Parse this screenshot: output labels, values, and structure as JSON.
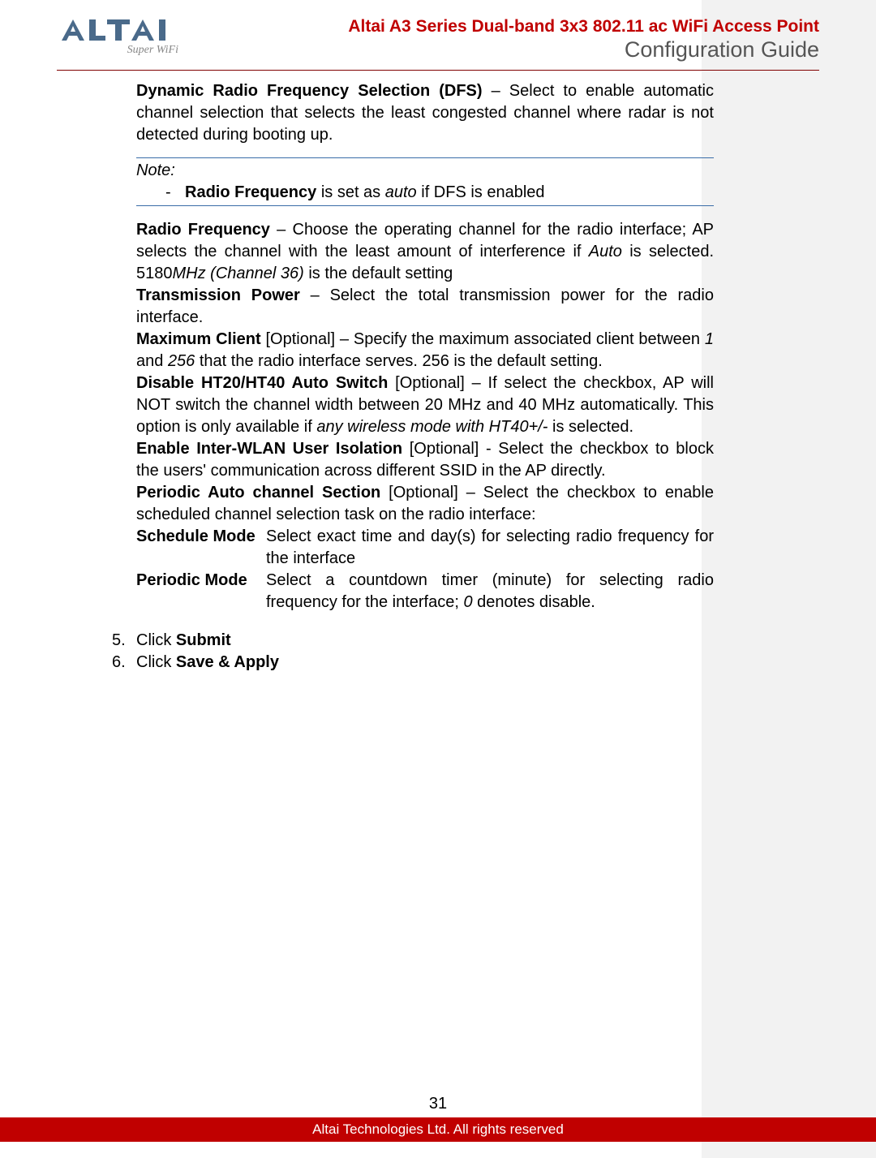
{
  "header": {
    "logo_text": "ALTAI",
    "logo_tagline": "Super WiFi",
    "title1": "Altai A3 Series Dual-band 3x3 802.11 ac WiFi Access Point",
    "title2": "Configuration Guide"
  },
  "content": {
    "dfs_bold": "Dynamic Radio Frequency Selection (DFS)",
    "dfs_text": " – Select to enable automatic channel selection that selects the least congested channel where radar is not detected during booting up.",
    "note_label": "Note:",
    "note_item_bold": "Radio Frequency",
    "note_item_mid": " is set as ",
    "note_item_italic": "auto",
    "note_item_end": " if DFS is enabled",
    "rf_bold": "Radio Frequency",
    "rf_text_a": " – Choose the operating channel for the radio interface; AP selects the channel with the least amount of interference if ",
    "rf_auto": "Auto",
    "rf_text_b": " is selected.  5180",
    "rf_mhz": "MHz (Channel 36)",
    "rf_text_c": " is the default setting",
    "tx_bold": "Transmission Power",
    "tx_text": " – Select the total transmission power for the radio interface.",
    "mc_bold": "Maximum Client",
    "mc_text_a": " [Optional] – Specify the maximum associated client between ",
    "mc_1": "1",
    "mc_text_b": " and ",
    "mc_256": "256",
    "mc_text_c": " that the radio interface serves. 256 is the default setting.",
    "ht_bold": "Disable HT20/HT40 Auto Switch",
    "ht_text_a": " [Optional] – If select the checkbox, AP will NOT switch the channel width between 20 MHz and 40 MHz automatically. This option is only available if ",
    "ht_italic": "any wireless mode with HT40+/-",
    "ht_text_b": " is selected.",
    "iw_bold": "Enable Inter-WLAN User Isolation",
    "iw_text": " [Optional] - Select the checkbox to block the users' communication across different SSID in the AP directly.",
    "pa_bold": "Periodic Auto channel Section",
    "pa_text": " [Optional] – Select the checkbox to enable scheduled channel selection task on the radio interface:",
    "schedule_label": "Schedule Mode",
    "schedule_text": "Select exact time and day(s) for selecting radio frequency for the interface",
    "periodic_label": "Periodic Mode",
    "periodic_text_a": "Select a countdown timer (minute) for selecting radio frequency for the interface; ",
    "periodic_zero": "0",
    "periodic_text_b": " denotes disable.",
    "step5_num": "5.",
    "step5_a": "Click ",
    "step5_b": "Submit",
    "step6_num": "6.",
    "step6_a": "Click ",
    "step6_b": "Save & Apply"
  },
  "footer": {
    "page_number": "31",
    "copyright": "Altai Technologies Ltd. All rights reserved"
  }
}
